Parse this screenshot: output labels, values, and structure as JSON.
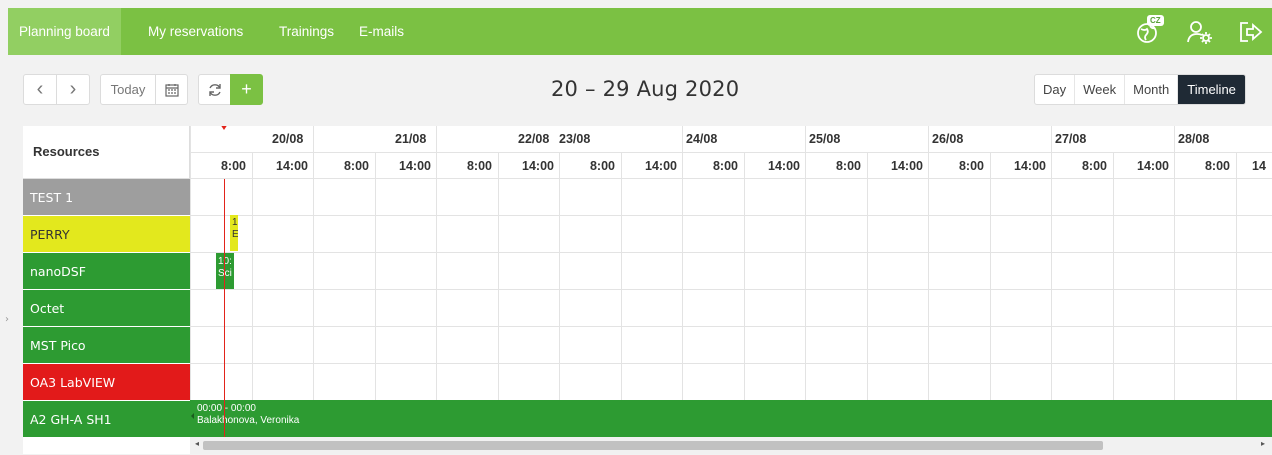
{
  "nav": {
    "tabs": [
      "Planning board",
      "My reservations",
      "Trainings",
      "E-mails"
    ],
    "active_tab": "Planning board",
    "lang_badge": "CZ",
    "icons": [
      "globe-language-icon",
      "user-settings-icon",
      "logout-icon"
    ]
  },
  "toolbar": {
    "prev_label": "‹",
    "next_label": "›",
    "today_label": "Today",
    "add_label": "+",
    "date_range": "20 – 29 Aug 2020",
    "views": [
      "Day",
      "Week",
      "Month",
      "Timeline"
    ],
    "active_view": "Timeline"
  },
  "grid": {
    "resources_header": "Resources",
    "days": [
      "20/08",
      "21/08",
      "22/08",
      "23/08",
      "24/08",
      "25/08",
      "26/08",
      "27/08",
      "28/08"
    ],
    "hours": [
      "8:00",
      "14:00",
      "8:00",
      "14:00",
      "8:00",
      "14:00",
      "8:00",
      "14:00",
      "8:00",
      "14:00",
      "8:00",
      "14:00",
      "8:00",
      "14:00",
      "8:00",
      "14:00",
      "8:00",
      "14"
    ],
    "resources": [
      {
        "name": "TEST 1",
        "color": "#9e9e9e",
        "text_color": "#ffffff"
      },
      {
        "name": "PERRY",
        "color": "#e3e81d",
        "text_color": "#333333"
      },
      {
        "name": "nanoDSF",
        "color": "#2d9b32",
        "text_color": "#ffffff"
      },
      {
        "name": "Octet",
        "color": "#2d9b32",
        "text_color": "#ffffff"
      },
      {
        "name": "MST Pico",
        "color": "#2d9b32",
        "text_color": "#ffffff"
      },
      {
        "name": "OA3 LabVIEW",
        "color": "#e21a1a",
        "text_color": "#ffffff"
      },
      {
        "name": "A2 GH-A SH1",
        "color": "#2d9b32",
        "text_color": "#ffffff"
      }
    ],
    "events": [
      {
        "line1": "1",
        "line2": "E",
        "color": "#e3e81d",
        "text_color": "#333333"
      },
      {
        "line1": "10:",
        "line2": "Sci",
        "color": "#2d9b32",
        "text_color": "#ffffff"
      },
      {
        "line1": "00:00 - 00:00",
        "line2": "Balakhonova, Veronika",
        "color": "#2d9b32",
        "text_color": "#ffffff"
      }
    ]
  }
}
